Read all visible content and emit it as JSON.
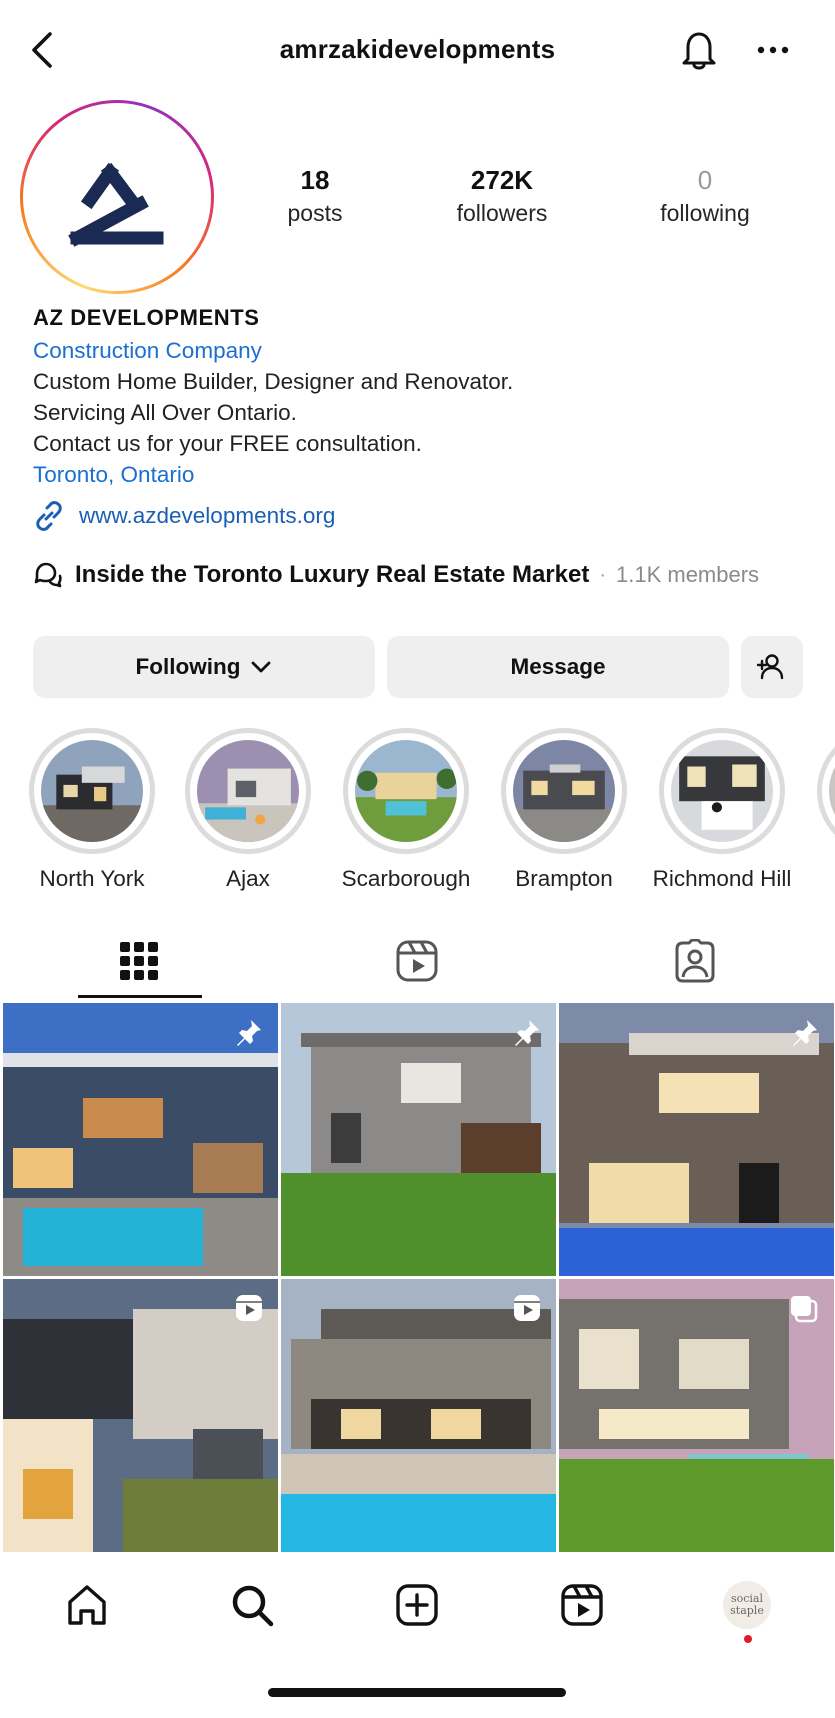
{
  "header": {
    "username": "amrzakidevelopments",
    "back_icon": "chevron-left-icon",
    "bell_icon": "bell-icon",
    "more_icon": "more-horizontal-icon"
  },
  "profile": {
    "logo_icon": "az-logo",
    "brand_color": "#1b2a52"
  },
  "stats": {
    "posts": {
      "value": "18",
      "label": "posts"
    },
    "followers": {
      "value": "272K",
      "label": "followers"
    },
    "following": {
      "value": "0",
      "label": "following"
    }
  },
  "bio": {
    "name": "AZ DEVELOPMENTS",
    "category": "Construction Company",
    "lines": [
      "Custom Home Builder, Designer and Renovator.",
      "Servicing All Over Ontario.",
      "Contact us for your FREE consultation."
    ],
    "location": "Toronto, Ontario",
    "website": "www.azdevelopments.org",
    "link_color": "#1a6fd0"
  },
  "community": {
    "title": "Inside the Toronto Luxury Real Estate Market",
    "separator": "·",
    "members": "1.1K members"
  },
  "actions": {
    "following_label": "Following",
    "message_label": "Message",
    "add_user_icon": "add-user-icon"
  },
  "highlights": [
    {
      "label": "North York"
    },
    {
      "label": "Ajax"
    },
    {
      "label": "Scarborough"
    },
    {
      "label": "Brampton"
    },
    {
      "label": "Richmond Hill"
    }
  ],
  "tabs": [
    {
      "icon": "grid-icon",
      "active": true
    },
    {
      "icon": "reels-icon",
      "active": false
    },
    {
      "icon": "tagged-icon",
      "active": false
    }
  ],
  "posts": [
    {
      "badge": "pin-icon"
    },
    {
      "badge": "pin-icon"
    },
    {
      "badge": "pin-icon"
    },
    {
      "badge": "reel-icon"
    },
    {
      "badge": "reel-icon"
    },
    {
      "badge": "carousel-icon"
    }
  ],
  "bottom_nav": {
    "items": [
      "home-icon",
      "search-icon",
      "create-icon",
      "reels-icon",
      "profile-avatar"
    ],
    "profile_avatar_text": [
      "social",
      "staple"
    ]
  }
}
